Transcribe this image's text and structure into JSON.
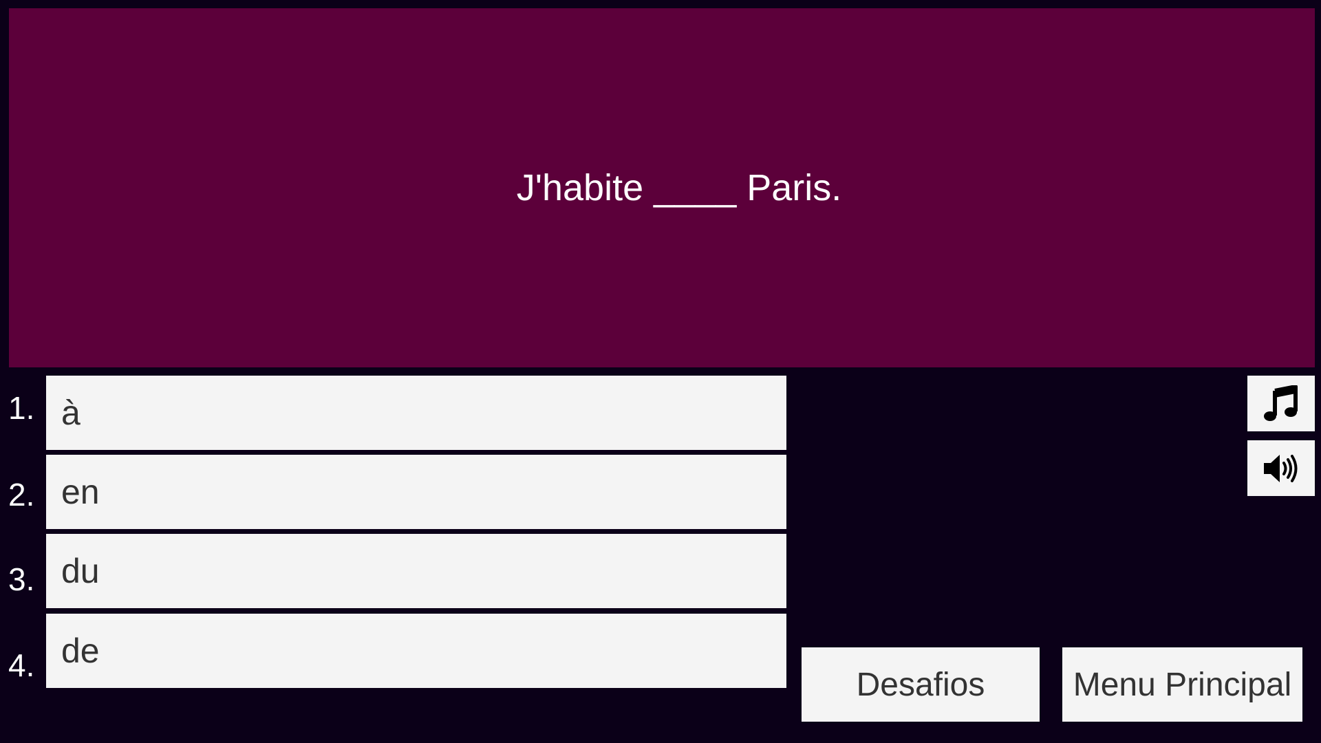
{
  "question": {
    "text": "J'habite ____ Paris."
  },
  "answers": [
    {
      "number": "1.",
      "label": "à"
    },
    {
      "number": "2.",
      "label": "en"
    },
    {
      "number": "3.",
      "label": "du"
    },
    {
      "number": "4.",
      "label": "de"
    }
  ],
  "controls": {
    "music_icon": "music-note-icon",
    "sound_icon": "speaker-icon"
  },
  "nav": {
    "challenges_label": "Desafios",
    "main_menu_label": "Menu Principal"
  },
  "colors": {
    "background": "#0b0018",
    "question_panel": "#5c003a",
    "button": "#f4f4f4",
    "button_text": "#333333"
  }
}
